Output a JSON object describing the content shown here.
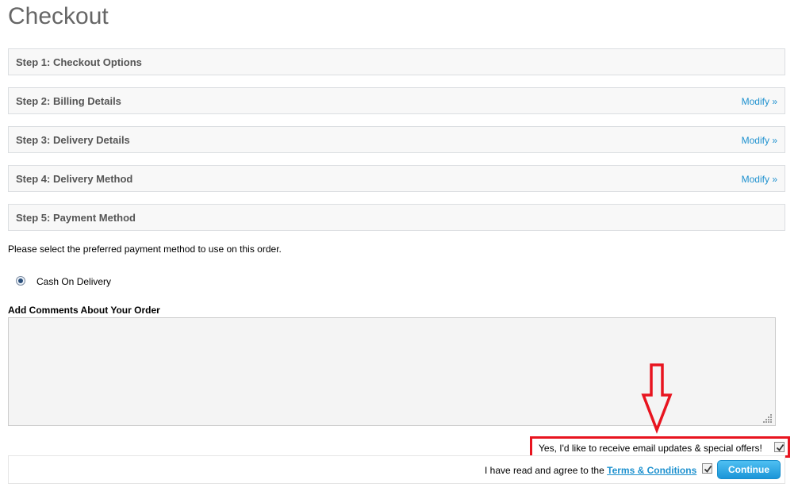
{
  "page": {
    "title": "Checkout"
  },
  "steps": [
    {
      "title": "Step 1: Checkout Options",
      "modify": ""
    },
    {
      "title": "Step 2: Billing Details",
      "modify": "Modify »"
    },
    {
      "title": "Step 3: Delivery Details",
      "modify": "Modify »"
    },
    {
      "title": "Step 4: Delivery Method",
      "modify": "Modify »"
    },
    {
      "title": "Step 5: Payment Method",
      "modify": ""
    }
  ],
  "payment": {
    "instruction": "Please select the preferred payment method to use on this order.",
    "option_label": "Cash On Delivery",
    "comments_label": "Add Comments About Your Order",
    "comments_value": ""
  },
  "newsletter": {
    "label": "Yes, I'd like to receive email updates & special offers!",
    "checked": true
  },
  "agree": {
    "prefix": "I have read and agree to the",
    "terms_link": "Terms & Conditions",
    "checked": true
  },
  "buttons": {
    "continue_label": "Continue"
  },
  "colors": {
    "link": "#1e91cf",
    "highlight_border": "#e8141f",
    "button": "#1b95d8"
  }
}
